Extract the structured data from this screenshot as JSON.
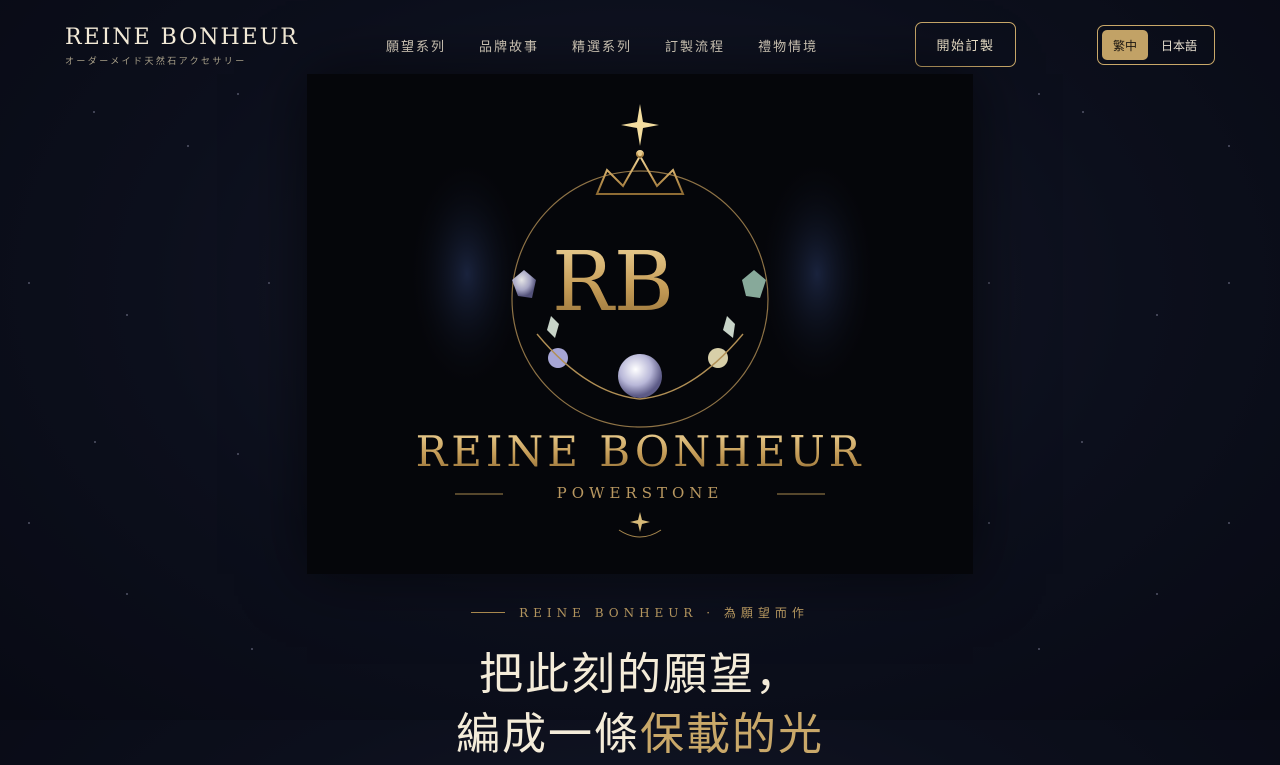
{
  "header": {
    "brand_name": "REINE BONHEUR",
    "brand_sub": "オーダーメイド天然石アクセサリー",
    "nav": [
      "願望系列",
      "品牌故事",
      "精選系列",
      "訂製流程",
      "禮物情境"
    ],
    "cta_label": "開始訂製",
    "lang_active": "繁中",
    "lang_other": "日本語"
  },
  "hero": {
    "monogram": "RB",
    "brand": "REINE BONHEUR",
    "sub": "POWERSTONE"
  },
  "tagline": "REINE BONHEUR · 為願望而作",
  "headline_line1": "把此刻的願望，",
  "headline_line2_a": "編成一條",
  "headline_line2_b": "保載的光",
  "colors": {
    "gold": "#c9a869",
    "background": "#0c0f1c"
  },
  "icons": [
    "crown-icon",
    "gem-icon",
    "sparkle-icon"
  ]
}
